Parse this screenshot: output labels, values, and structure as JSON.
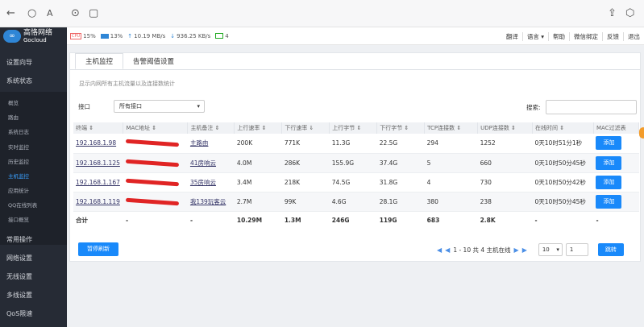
{
  "browser": {
    "back": "←",
    "refresh": "○",
    "font": "A",
    "link": "⊙",
    "tab": "▢",
    "share": "⇪",
    "ext": "⬡"
  },
  "logo": {
    "mark": "∞",
    "name": "高恪网络",
    "sub": "Gocloud"
  },
  "sidebar": {
    "groups": [
      {
        "label": "设置向导"
      },
      {
        "label": "系统状态"
      },
      {
        "label": "常用操作"
      },
      {
        "label": "网络设置"
      },
      {
        "label": "无线设置"
      },
      {
        "label": "多线设置"
      },
      {
        "label": "QoS限速"
      }
    ],
    "subs": [
      {
        "label": "概览"
      },
      {
        "label": "路由"
      },
      {
        "label": "系统日志"
      },
      {
        "label": "实时监控"
      },
      {
        "label": "历史监控"
      },
      {
        "label": "主机监控"
      },
      {
        "label": "应用统计"
      },
      {
        "label": "QQ在线列表"
      },
      {
        "label": "接口概览"
      }
    ]
  },
  "status": {
    "cpu": "15%",
    "mem": "13%",
    "up": "10.19 MB/s",
    "down": "936.25 KB/s",
    "online": "4"
  },
  "topnav": {
    "items": [
      "翻译",
      "语言 ▾",
      "帮助",
      "微信绑定",
      "反馈",
      "退出"
    ]
  },
  "tabs": {
    "host": "主机监控",
    "alert": "告警阈值设置"
  },
  "desc": "显示内网所有主机流量以及连接数统计",
  "filter": {
    "port_label": "接口",
    "port_value": "所有接口",
    "search_label": "搜索:"
  },
  "table": {
    "headers": [
      "终端 ⇕",
      "MAC地址 ⇕",
      "主机备注 ⇕",
      "上行速率 ⇕",
      "下行速率 ⇓",
      "上行字节 ⇕",
      "下行字节 ⇕",
      "TCP连接数 ⇕",
      "UDP连接数 ⇕",
      "在线时间 ⇕",
      "MAC过滤表"
    ],
    "rows": [
      {
        "ip": "192.168.1.98",
        "note": "主路由",
        "up": "200K",
        "down": "771K",
        "ub": "11.3G",
        "db": "22.5G",
        "tcp": "294",
        "udp": "1252",
        "time": "0天10时51分1秒",
        "btn": "添加"
      },
      {
        "ip": "192.168.1.125",
        "note": "41房响云",
        "up": "4.0M",
        "down": "286K",
        "ub": "155.9G",
        "db": "37.4G",
        "tcp": "5",
        "udp": "660",
        "time": "0天10时50分45秒",
        "btn": "添加"
      },
      {
        "ip": "192.168.1.167",
        "note": "35房响云",
        "up": "3.4M",
        "down": "218K",
        "ub": "74.5G",
        "db": "31.8G",
        "tcp": "4",
        "udp": "730",
        "time": "0天10时50分42秒",
        "btn": "添加"
      },
      {
        "ip": "192.168.1.119",
        "note": "我139玩客云",
        "up": "2.7M",
        "down": "99K",
        "ub": "4.6G",
        "db": "28.1G",
        "tcp": "380",
        "udp": "238",
        "time": "0天10时50分45秒",
        "btn": "添加"
      }
    ],
    "total": {
      "label": "合计",
      "mac": "-",
      "note": "-",
      "up": "10.29M",
      "down": "1.3M",
      "ub": "246G",
      "db": "119G",
      "tcp": "683",
      "udp": "2.8K",
      "time": "-",
      "mf": "-"
    }
  },
  "pause": "暂停刷新",
  "pager": {
    "first": "◀",
    "prev": "◀",
    "info": "1 - 10 共 4 主机在线",
    "next": "▶",
    "last": "▶",
    "size": "10",
    "page": "1",
    "jump": "跳转"
  }
}
